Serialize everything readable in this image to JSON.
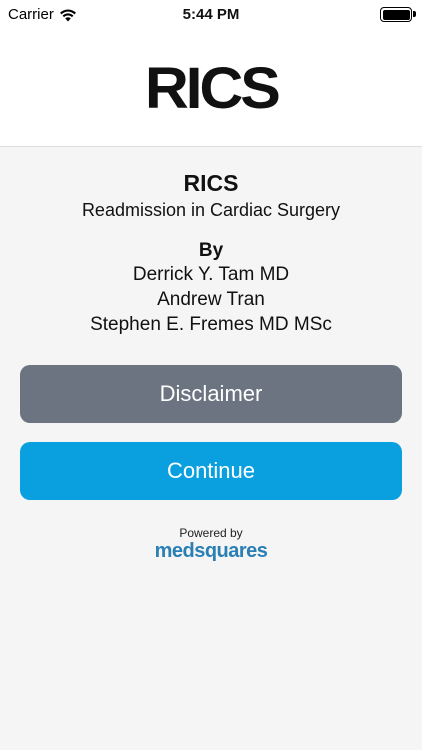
{
  "status_bar": {
    "carrier": "Carrier",
    "time": "5:44 PM",
    "icons": [
      "wifi-icon",
      "battery-icon"
    ]
  },
  "header": {
    "logo_text": "RICS"
  },
  "main": {
    "title": "RICS",
    "subtitle": "Readmission in Cardiac Surgery",
    "by_label": "By",
    "authors": [
      "Derrick Y. Tam MD",
      "Andrew Tran",
      "Stephen E. Fremes MD MSc"
    ]
  },
  "buttons": {
    "disclaimer_label": "Disclaimer",
    "continue_label": "Continue"
  },
  "footer": {
    "powered_by": "Powered by",
    "brand": "medsquares"
  },
  "colors": {
    "disclaimer_bg": "#6b7480",
    "continue_bg": "#0aa0e0",
    "brand": "#2a7fb5"
  }
}
